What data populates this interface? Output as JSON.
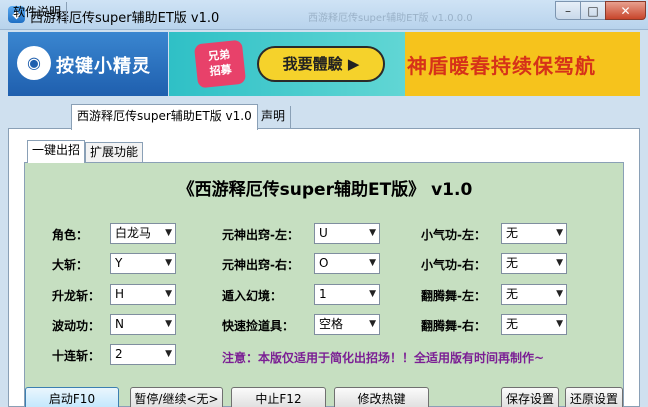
{
  "window": {
    "title": "西游释厄传super辅助ET版 v1.0",
    "ghost_title": "西游释厄传super辅助ET版 v1.0.0.0",
    "minimize": "–",
    "maximize": "□",
    "close": "✕"
  },
  "banner": {
    "logo_text": "按键小精灵",
    "ad_badge": "兄弟\n招募",
    "ad_cta": "我要體驗 ▶",
    "ad_slogan": "神盾暖春持续保驾航"
  },
  "outer_tabs": [
    "软件说明",
    "西游释厄传super辅助ET版 v1.0",
    "声明"
  ],
  "inner_tabs": [
    "一键出招",
    "扩展功能"
  ],
  "heading": "《西游释厄传super辅助ET版》 v1.0",
  "fields_col1": [
    {
      "label": "角色：",
      "value": "白龙马"
    },
    {
      "label": "大斩：",
      "value": "Y"
    },
    {
      "label": "升龙斩：",
      "value": "H"
    },
    {
      "label": "波动功：",
      "value": "N"
    },
    {
      "label": "十连斩：",
      "value": "2"
    }
  ],
  "fields_col2": [
    {
      "label": "元神出窍-左：",
      "value": "U"
    },
    {
      "label": "元神出窍-右：",
      "value": "O"
    },
    {
      "label": "遁入幻境：",
      "value": "1"
    },
    {
      "label": "快速捡道具：",
      "value": "空格"
    }
  ],
  "fields_col3": [
    {
      "label": "小气功-左：",
      "value": "无"
    },
    {
      "label": "小气功-右：",
      "value": "无"
    },
    {
      "label": "翻腾舞-左：",
      "value": "无"
    },
    {
      "label": "翻腾舞-右：",
      "value": "无"
    }
  ],
  "notice": "注意：本版仅适用于简化出招场！！全适用版有时间再制作~",
  "buttons": {
    "start": "启动F10",
    "pause": "暂停/继续<无>",
    "stop": "中止F12",
    "hotkey": "修改热键",
    "save": "保存设置",
    "restore": "还原设置"
  },
  "colors": {
    "panel_green": "#c6dfc1",
    "notice_purple": "#7b1f94",
    "slogan_red": "#d63219",
    "ad_yellow": "#f6c31c",
    "logo_blue": "#1f5fae"
  }
}
